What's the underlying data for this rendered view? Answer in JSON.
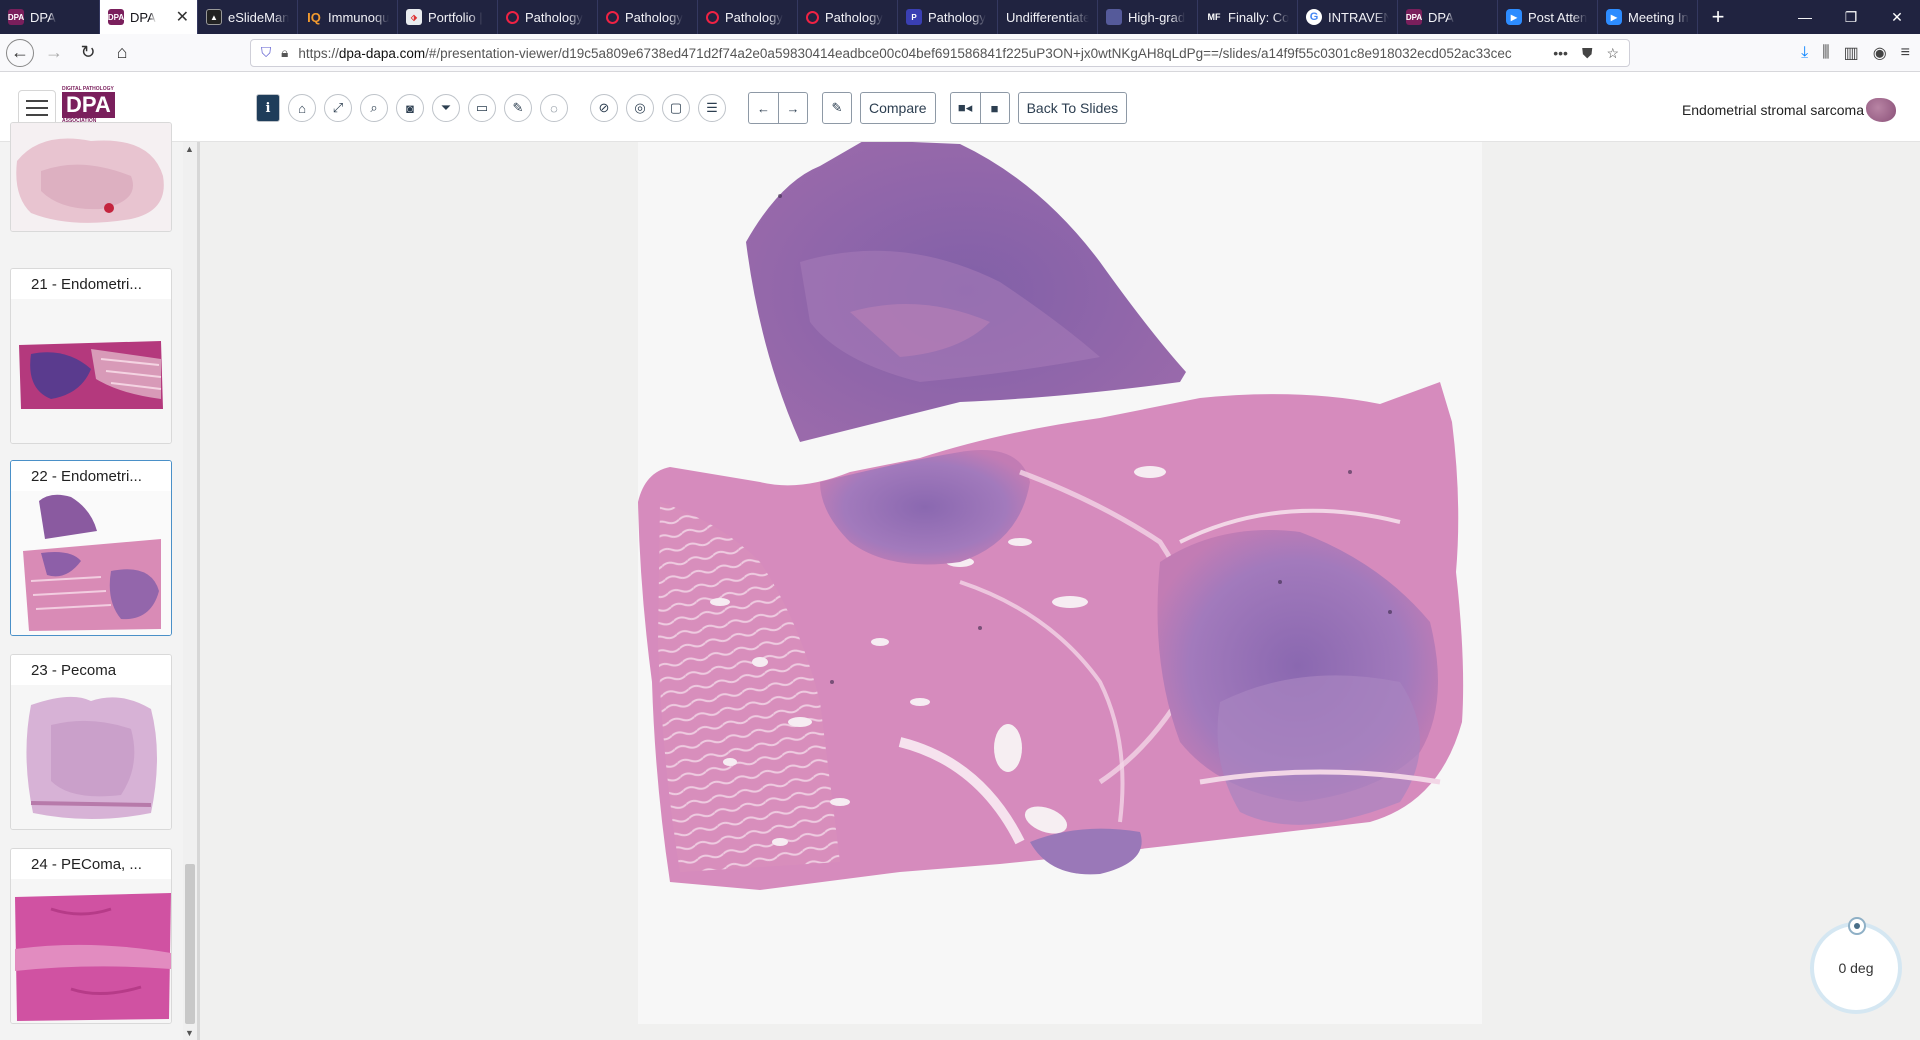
{
  "browser": {
    "tabs": [
      {
        "label": "DPA",
        "icon": "dpa-favicon-icon",
        "active": false
      },
      {
        "label": "DPA",
        "icon": "dpa-favicon-icon",
        "active": true
      },
      {
        "label": "eSlideMan",
        "icon": "eslide-favicon-icon",
        "active": false
      },
      {
        "label": "Immunoqu",
        "icon": "iq-favicon-icon",
        "active": false
      },
      {
        "label": "Portfolio |",
        "icon": "portfolio-favicon-icon",
        "active": false
      },
      {
        "label": "Pathology",
        "icon": "pathology-favicon-icon",
        "active": false
      },
      {
        "label": "Pathology",
        "icon": "pathology-favicon-icon",
        "active": false
      },
      {
        "label": "Pathology",
        "icon": "pathology-favicon-icon",
        "active": false
      },
      {
        "label": "Pathology",
        "icon": "pathology-favicon-icon",
        "active": false
      },
      {
        "label": "Pathology",
        "icon": "pathology-alt-favicon-icon",
        "active": false
      },
      {
        "label": "Undifferentiate",
        "icon": "",
        "active": false
      },
      {
        "label": "High-grad",
        "icon": "document-favicon-icon",
        "active": false
      },
      {
        "label": "Finally: Co",
        "icon": "mf-favicon-icon",
        "active": false
      },
      {
        "label": "INTRAVEN",
        "icon": "google-favicon-icon",
        "active": false
      },
      {
        "label": "DPA",
        "icon": "dpa-favicon-icon",
        "active": false
      },
      {
        "label": "Post Atten",
        "icon": "zoom-favicon-icon",
        "active": false
      },
      {
        "label": "Meeting In",
        "icon": "zoom-favicon-icon",
        "active": false
      }
    ],
    "url_prefix": "https://",
    "url_host": "dpa-dapa.com",
    "url_path": "/#/presentation-viewer/d19c5a809e6738ed471d2f74a2e0a59830414eadbce00c04bef691586841f225uP3ON+jx0wtNKgAH8qLdPg==/slides/a14f9f55c0301c8e918032ecd052ac33cec"
  },
  "app": {
    "logo_small": "DIGITAL PATHOLOGY",
    "logo_big": "DPA",
    "logo_bottom": "ASSOCIATION",
    "toolbar": {
      "compare_label": "Compare",
      "back_label": "Back To Slides"
    },
    "slide_title": "Endometrial stromal sarcoma"
  },
  "sidebar": {
    "cards": [
      {
        "label": ""
      },
      {
        "label": "21 - Endometri..."
      },
      {
        "label": "22 - Endometri..."
      },
      {
        "label": "23 - Pecoma"
      },
      {
        "label": "24 - PEComa, ..."
      }
    ]
  },
  "viewer": {
    "rotation_label": "0 deg",
    "rotation_degrees": 0
  },
  "colors": {
    "brand": "#7a1f5c",
    "tab_strip": "#202340",
    "selection": "#4a90c8"
  }
}
